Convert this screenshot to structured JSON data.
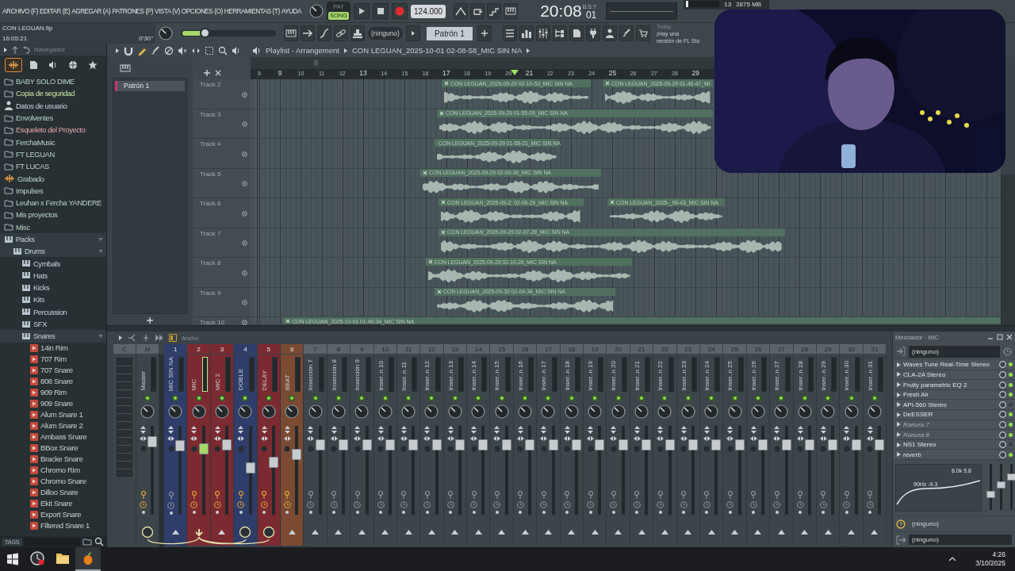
{
  "menu": [
    "ARCHIVO (F)",
    "EDITAR (E)",
    "AGREGAR (A)",
    "PATRONES (P)",
    "VISTA (V)",
    "OPCIONES (O)",
    "HERRAMIENTAS (T)",
    "AYUDA"
  ],
  "project": {
    "file": "CON LEGUAN.flp",
    "clock": "16:05:21",
    "duration": "0'30\""
  },
  "transport": {
    "modes": [
      {
        "label": "PAT",
        "selected": false
      },
      {
        "label": "SONG",
        "selected": true
      }
    ],
    "tempo": "124.000",
    "time": "20:08",
    "time_ticks": "01",
    "time_unit": "B:S:T"
  },
  "monitor": {
    "cpu": "13",
    "memory": "2875 MB",
    "level": 0.06
  },
  "master_volume": {
    "level": 0.23
  },
  "toolbar": {
    "pattern_selector": "(ninguno)",
    "pattern": "Patrón 1"
  },
  "news": {
    "label": "Today",
    "lines": [
      "¡Hay una",
      "versión de FL Stu"
    ]
  },
  "browser": {
    "title": "Navegador",
    "tabs": [
      {
        "kind": "all",
        "selected": true
      },
      {
        "kind": "files",
        "selected": false
      },
      {
        "kind": "sounds",
        "selected": false
      },
      {
        "kind": "web",
        "selected": false
      },
      {
        "kind": "starred",
        "selected": false
      }
    ],
    "items": [
      {
        "label": "BABY SOLO DIME",
        "kind": "folder",
        "expanded": false
      },
      {
        "label": "Copia de seguridad",
        "kind": "backup",
        "expanded": false
      },
      {
        "label": "Datos de usuario",
        "kind": "user",
        "expanded": false
      },
      {
        "label": "Envolventes",
        "kind": "folder",
        "expanded": false
      },
      {
        "label": "Esqueleto del Proyecto",
        "kind": "template",
        "expanded": false
      },
      {
        "label": "FerchaMusic",
        "kind": "folder",
        "expanded": false
      },
      {
        "label": "FT LEGUAN",
        "kind": "folder",
        "expanded": false
      },
      {
        "label": "FT LUCAS",
        "kind": "folder",
        "expanded": false
      },
      {
        "label": "Grabado",
        "kind": "recording",
        "expanded": false
      },
      {
        "label": "Impulses",
        "kind": "folder",
        "expanded": false
      },
      {
        "label": "Leuhan x Fercha YANDERE",
        "kind": "folder",
        "expanded": false
      },
      {
        "label": "Mis proyectos",
        "kind": "folder",
        "expanded": false
      },
      {
        "label": "Misc",
        "kind": "folder",
        "expanded": false
      },
      {
        "label": "Packs",
        "kind": "pack",
        "expanded": true,
        "children": [
          {
            "label": "Drums",
            "kind": "pack",
            "expanded": true,
            "children": [
              {
                "label": "Cymbals",
                "kind": "pack",
                "expanded": false
              },
              {
                "label": "Hats",
                "kind": "pack",
                "expanded": false
              },
              {
                "label": "Kicks",
                "kind": "pack",
                "expanded": false
              },
              {
                "label": "Kits",
                "kind": "pack",
                "expanded": false
              },
              {
                "label": "Percussion",
                "kind": "pack",
                "expanded": false
              },
              {
                "label": "SFX",
                "kind": "pack",
                "expanded": false
              },
              {
                "label": "Snares",
                "kind": "pack",
                "expanded": true,
                "children": [
                  {
                    "label": "14in Rim",
                    "kind": "sample"
                  },
                  {
                    "label": "707 Rim",
                    "kind": "sample"
                  },
                  {
                    "label": "707 Snare",
                    "kind": "sample"
                  },
                  {
                    "label": "808 Snare",
                    "kind": "sample"
                  },
                  {
                    "label": "909 Rim",
                    "kind": "sample"
                  },
                  {
                    "label": "909 Snare",
                    "kind": "sample"
                  },
                  {
                    "label": "Alum Snare 1",
                    "kind": "sample"
                  },
                  {
                    "label": "Alum Snare 2",
                    "kind": "sample"
                  },
                  {
                    "label": "Ambass Snare",
                    "kind": "sample"
                  },
                  {
                    "label": "BBox Snare",
                    "kind": "sample"
                  },
                  {
                    "label": "Bracke Snare",
                    "kind": "sample"
                  },
                  {
                    "label": "Chromo Rim",
                    "kind": "sample"
                  },
                  {
                    "label": "Chromo Snare",
                    "kind": "sample"
                  },
                  {
                    "label": "Dilloo Snare",
                    "kind": "sample"
                  },
                  {
                    "label": "Ekit Snare",
                    "kind": "sample"
                  },
                  {
                    "label": "Export Snare",
                    "kind": "sample"
                  },
                  {
                    "label": "Filtered Snare 1",
                    "kind": "sample"
                  }
                ]
              }
            ]
          }
        ]
      }
    ],
    "tags_button": "TAGS"
  },
  "playlist": {
    "title": "Playlist - Arrangement",
    "crumb": "CON LEGUAN_2025-10-01 02-08-58_MIC SIN NA",
    "patterns": [
      "Patrón 1"
    ],
    "ruler": [
      "8",
      "9",
      "10",
      "11",
      "12",
      "13",
      "14",
      "15",
      "16",
      "17",
      "18",
      "19",
      "20",
      "21",
      "22",
      "23",
      "24",
      "25",
      "26",
      "27",
      "28",
      "29"
    ],
    "tracks": [
      {
        "name": "Track 2",
        "clips": [
          {
            "label": "CON LEGUAN_2025-09-29 02-10-53_MIC SIN NA"
          },
          {
            "label": "CON LEGUAN_2025-09-29 01-46-47_MI"
          }
        ]
      },
      {
        "name": "Track 3",
        "clips": [
          {
            "label": "CON LEGUAN_2025-09-29 01-55-05_MIC SIN NA"
          }
        ]
      },
      {
        "name": "Track 4",
        "clips": [
          {
            "label": "CON LEGUAN_2025-09-29 01-58-21_MIC SIN NA"
          }
        ]
      },
      {
        "name": "Track 5",
        "clips": [
          {
            "label": "CON LEGUAN_2025-09-29 02-00-36_MIC SIN NA"
          }
        ]
      },
      {
        "name": "Track 6",
        "clips": [
          {
            "label": "CON LEGUAN_2025-09-2: 02-06-29_MIC SIN NA"
          },
          {
            "label": "CON LEGUAN_2025-_06-43_MIC SIN NA"
          }
        ]
      },
      {
        "name": "Track 7",
        "clips": [
          {
            "label": "CON LEGUAN_2025-09-29 02-07-28_MIC SIN NA"
          }
        ]
      },
      {
        "name": "Track 8",
        "clips": [
          {
            "label": "CON LEGUAN_2025-09-29 02-10-29_MIC SIN NA"
          }
        ]
      },
      {
        "name": "Track 9",
        "clips": [
          {
            "label": "CON LEGUAN_2025-09-30 02-04-34_MIC SIN NA"
          }
        ]
      },
      {
        "name": "Track 10",
        "clips": [
          {
            "label": "CON LEGUAN_2025-10-01 01-40-34_MIC SIN NA"
          }
        ]
      }
    ]
  },
  "mixer": {
    "toolbar_label": "Ancho",
    "title": "Mezclador - MIC",
    "channels": [
      {
        "number": "C",
        "kind": "meter"
      },
      {
        "number": "M",
        "name": "Master",
        "kind": "master",
        "selected": false,
        "level": 0.86,
        "armed": true,
        "send_target": true,
        "send_source": false
      },
      {
        "number": "1",
        "name": "MIC SIN NA",
        "kind": "insert",
        "color": "#2f3d6a",
        "selected": false,
        "level": 0.82,
        "armed": false,
        "send_target": false,
        "send_source": false
      },
      {
        "number": "2",
        "name": "MIC",
        "kind": "insert",
        "color": "#7c2a31",
        "selected": true,
        "level": 0.77,
        "armed": true,
        "send_target": false,
        "send_source": true
      },
      {
        "number": "3",
        "name": "MIC 2",
        "kind": "insert",
        "color": "#7c2a31",
        "selected": false,
        "level": 0.82,
        "armed": true,
        "send_target": false,
        "send_source": false
      },
      {
        "number": "4",
        "name": "DOBLE",
        "kind": "insert",
        "color": "#2f3d6a",
        "selected": false,
        "level": 0.53,
        "armed": true,
        "send_target": true,
        "send_source": false
      },
      {
        "number": "5",
        "name": "DELAY",
        "kind": "insert",
        "color": "#7c2a31",
        "selected": false,
        "level": 0.6,
        "armed": true,
        "send_target": true,
        "send_source": false
      },
      {
        "number": "6",
        "name": "BEAT",
        "kind": "insert",
        "color": "#7a4a32",
        "selected": false,
        "level": 0.7,
        "armed": true,
        "send_target": false,
        "send_source": false
      },
      {
        "number": "7",
        "name": "Inserción 7",
        "kind": "insert",
        "selected": false,
        "level": 0.82,
        "armed": false,
        "send_target": false,
        "send_source": false
      },
      {
        "number": "8",
        "name": "Inserción 8",
        "kind": "insert",
        "selected": false,
        "level": 0.82,
        "armed": false,
        "send_target": false,
        "send_source": false
      },
      {
        "number": "9",
        "name": "Inserción 9",
        "kind": "insert",
        "selected": false,
        "level": 0.82,
        "armed": false,
        "send_target": false,
        "send_source": false
      },
      {
        "number": "10",
        "name": "Inser..n 10",
        "kind": "insert",
        "selected": false,
        "level": 0.82,
        "armed": false,
        "send_target": false,
        "send_source": false
      },
      {
        "number": "11",
        "name": "Inser..n 11",
        "kind": "insert",
        "selected": false,
        "level": 0.82,
        "armed": false,
        "send_target": false,
        "send_source": false
      },
      {
        "number": "12",
        "name": "Inser..n 12",
        "kind": "insert",
        "selected": false,
        "level": 0.82,
        "armed": false,
        "send_target": false,
        "send_source": false
      },
      {
        "number": "13",
        "name": "Inser..n 13",
        "kind": "insert",
        "selected": false,
        "level": 0.82,
        "armed": false,
        "send_target": false,
        "send_source": false
      },
      {
        "number": "14",
        "name": "Inser..n 14",
        "kind": "insert",
        "selected": false,
        "level": 0.82,
        "armed": false,
        "send_target": false,
        "send_source": false
      },
      {
        "number": "15",
        "name": "Inser..n 15",
        "kind": "insert",
        "selected": false,
        "level": 0.82,
        "armed": false,
        "send_target": false,
        "send_source": false
      },
      {
        "number": "16",
        "name": "Inser..n 16",
        "kind": "insert",
        "selected": false,
        "level": 0.82,
        "armed": false,
        "send_target": false,
        "send_source": false
      },
      {
        "number": "17",
        "name": "Inser..n 17",
        "kind": "insert",
        "selected": false,
        "level": 0.82,
        "armed": false,
        "send_target": false,
        "send_source": false
      },
      {
        "number": "18",
        "name": "Inser..n 18",
        "kind": "insert",
        "selected": false,
        "level": 0.82,
        "armed": false,
        "send_target": false,
        "send_source": false
      },
      {
        "number": "19",
        "name": "Inser..n 19",
        "kind": "insert",
        "selected": false,
        "level": 0.82,
        "armed": false,
        "send_target": false,
        "send_source": false
      },
      {
        "number": "20",
        "name": "Inser..n 20",
        "kind": "insert",
        "selected": false,
        "level": 0.82,
        "armed": false,
        "send_target": false,
        "send_source": false
      },
      {
        "number": "21",
        "name": "Inser..n 21",
        "kind": "insert",
        "selected": false,
        "level": 0.82,
        "armed": false,
        "send_target": false,
        "send_source": false
      },
      {
        "number": "22",
        "name": "Inser..n 22",
        "kind": "insert",
        "selected": false,
        "level": 0.82,
        "armed": false,
        "send_target": false,
        "send_source": false
      },
      {
        "number": "23",
        "name": "Inser..n 23",
        "kind": "insert",
        "selected": false,
        "level": 0.82,
        "armed": false,
        "send_target": false,
        "send_source": false
      },
      {
        "number": "24",
        "name": "Inser..n 24",
        "kind": "insert",
        "selected": false,
        "level": 0.82,
        "armed": false,
        "send_target": false,
        "send_source": false
      },
      {
        "number": "25",
        "name": "Inser..n 25",
        "kind": "insert",
        "selected": false,
        "level": 0.82,
        "armed": false,
        "send_target": false,
        "send_source": false
      },
      {
        "number": "26",
        "name": "Inser..n 26",
        "kind": "insert",
        "selected": false,
        "level": 0.82,
        "armed": false,
        "send_target": false,
        "send_source": false
      },
      {
        "number": "27",
        "name": "Inser..n 27",
        "kind": "insert",
        "selected": false,
        "level": 0.82,
        "armed": false,
        "send_target": false,
        "send_source": false
      },
      {
        "number": "28",
        "name": "Inser..n 28",
        "kind": "insert",
        "selected": false,
        "level": 0.82,
        "armed": false,
        "send_target": false,
        "send_source": false
      },
      {
        "number": "29",
        "name": "Inser..n 29",
        "kind": "insert",
        "selected": false,
        "level": 0.82,
        "armed": false,
        "send_target": false,
        "send_source": false
      },
      {
        "number": "30",
        "name": "Inser..n 30",
        "kind": "insert",
        "selected": false,
        "level": 0.82,
        "armed": false,
        "send_target": false,
        "send_source": false
      },
      {
        "number": "31",
        "name": "Inser..n 31",
        "kind": "insert",
        "selected": false,
        "level": 0.82,
        "armed": false,
        "send_target": false,
        "send_source": false
      }
    ],
    "input": "(ninguno)",
    "inserts": [
      {
        "name": "Waves Tune Real-Time Stereo",
        "kind": "plugin",
        "on": true
      },
      {
        "name": "CLA-2A Stereo",
        "kind": "plugin",
        "on": true
      },
      {
        "name": "Fruity parametric EQ 2",
        "kind": "plugin",
        "on": true
      },
      {
        "name": "Fresh Air",
        "kind": "plugin",
        "on": true
      },
      {
        "name": "API-560 Stereo",
        "kind": "plugin",
        "on": false
      },
      {
        "name": "DeESSER",
        "kind": "plugin",
        "on": true
      },
      {
        "name": "Ranura 7",
        "kind": "empty",
        "on": true
      },
      {
        "name": "Ranura 8",
        "kind": "empty",
        "on": true
      },
      {
        "name": "NS1 Stereo",
        "kind": "plugin",
        "on": false
      },
      {
        "name": "reverb",
        "kind": "plugin",
        "on": true
      }
    ],
    "eq_labels": [
      "90Hz -9.3",
      "8.0k 5.8"
    ],
    "eq_bands": [
      {
        "level": 0.3
      },
      {
        "level": 0.55
      },
      {
        "level": 0.75
      }
    ],
    "sends": [
      {
        "kind": "clock",
        "label": "(ninguno)"
      },
      {
        "kind": "output",
        "label": "(ninguno)"
      }
    ]
  },
  "taskbar": {
    "apps": [
      {
        "kind": "recorder",
        "selected": false
      },
      {
        "kind": "explorer",
        "selected": false
      },
      {
        "kind": "daw",
        "selected": true
      }
    ],
    "time": "4:26",
    "date": "3/10/2025"
  }
}
